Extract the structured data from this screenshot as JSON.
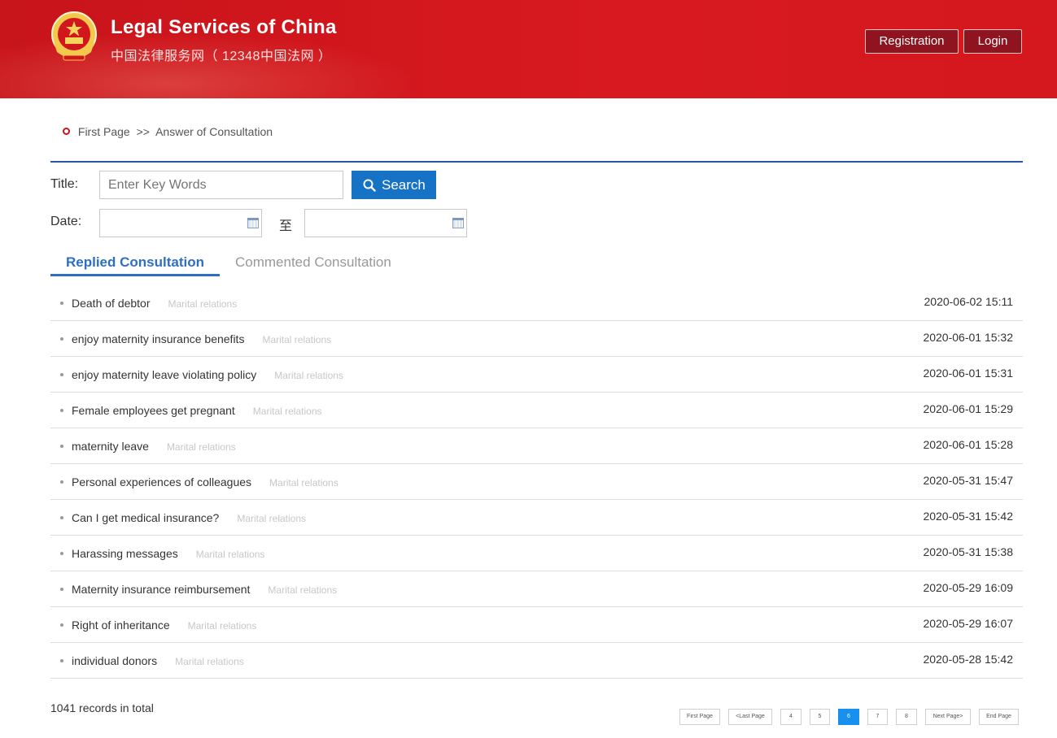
{
  "header": {
    "title": "Legal Services of China",
    "subtitle": "中国法律服务网（ 12348中国法网 ）",
    "registration_label": "Registration",
    "login_label": "Login",
    "brand_color": "#c8141b"
  },
  "breadcrumb": {
    "home": "First Page",
    "separator": ">>",
    "current": "Answer of Consultation"
  },
  "search": {
    "title_label": "Title:",
    "title_placeholder": "Enter Key Words",
    "button_label": "Search",
    "date_label": "Date:",
    "date_separator": "至",
    "button_color": "#1672c4"
  },
  "tabs": [
    {
      "label": "Replied Consultation",
      "active": true
    },
    {
      "label": "Commented Consultation",
      "active": false
    }
  ],
  "items": [
    {
      "title": "Death of debtor",
      "category": "Marital relations",
      "date": "2020-06-02 15:11"
    },
    {
      "title": "enjoy maternity insurance benefits",
      "category": "Marital relations",
      "date": "2020-06-01 15:32"
    },
    {
      "title": "enjoy maternity leave violating policy",
      "category": "Marital relations",
      "date": "2020-06-01 15:31"
    },
    {
      "title": "Female employees get pregnant",
      "category": "Marital relations",
      "date": "2020-06-01 15:29"
    },
    {
      "title": "maternity leave",
      "category": "Marital relations",
      "date": "2020-06-01 15:28"
    },
    {
      "title": "Personal experiences of colleagues",
      "category": "Marital relations",
      "date": "2020-05-31 15:47"
    },
    {
      "title": "Can I get medical insurance?",
      "category": "Marital relations",
      "date": "2020-05-31 15:42"
    },
    {
      "title": "Harassing messages",
      "category": "Marital relations",
      "date": "2020-05-31 15:38"
    },
    {
      "title": "Maternity insurance reimbursement",
      "category": "Marital relations",
      "date": "2020-05-29 16:09"
    },
    {
      "title": "Right of inheritance",
      "category": "Marital relations",
      "date": "2020-05-29 16:07"
    },
    {
      "title": "individual donors",
      "category": "Marital relations",
      "date": "2020-05-28 15:42"
    }
  ],
  "footer": {
    "total_text": "1041 records in total",
    "pagination": {
      "first": "First Page",
      "prev": "<Last Page",
      "pages": [
        "4",
        "5",
        "6",
        "7",
        "8"
      ],
      "current": "6",
      "next": "Next Page>",
      "last": "End Page"
    }
  }
}
